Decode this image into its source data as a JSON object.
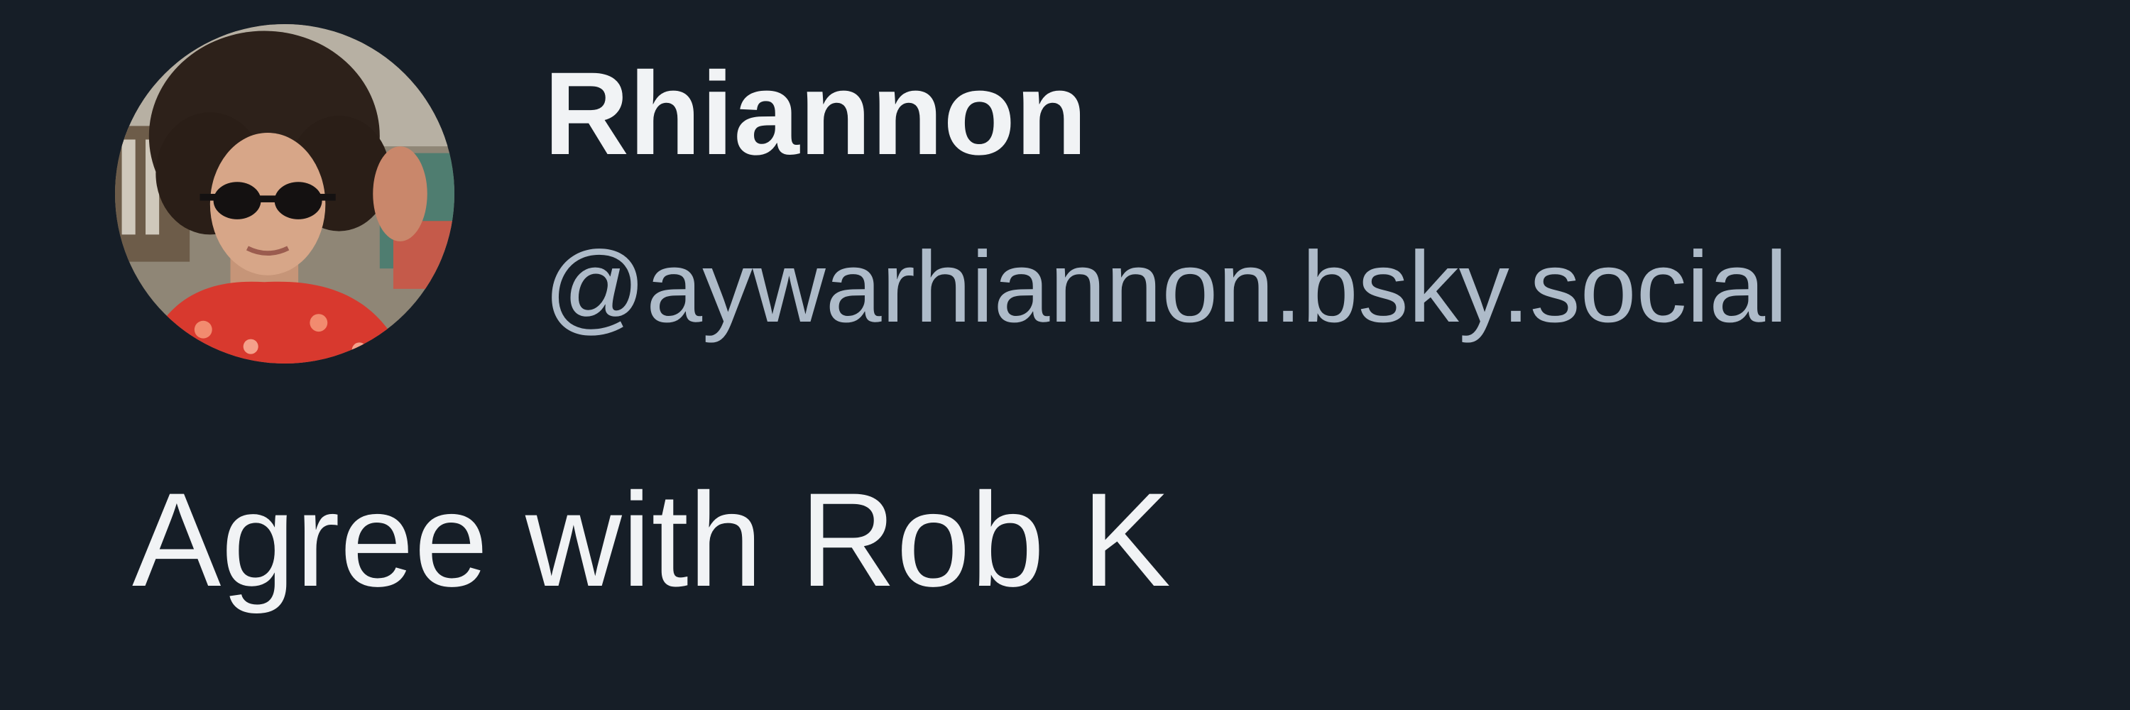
{
  "colors": {
    "background": "#161e27",
    "name": "#f1f3f5",
    "handle": "#aebbc9",
    "text": "#f1f3f5"
  },
  "author": {
    "display_name": "Rhiannon",
    "handle": "@aywarhiannon.bsky.social",
    "avatar_icon": "profile-photo"
  },
  "post": {
    "text": "Agree with Rob K"
  }
}
